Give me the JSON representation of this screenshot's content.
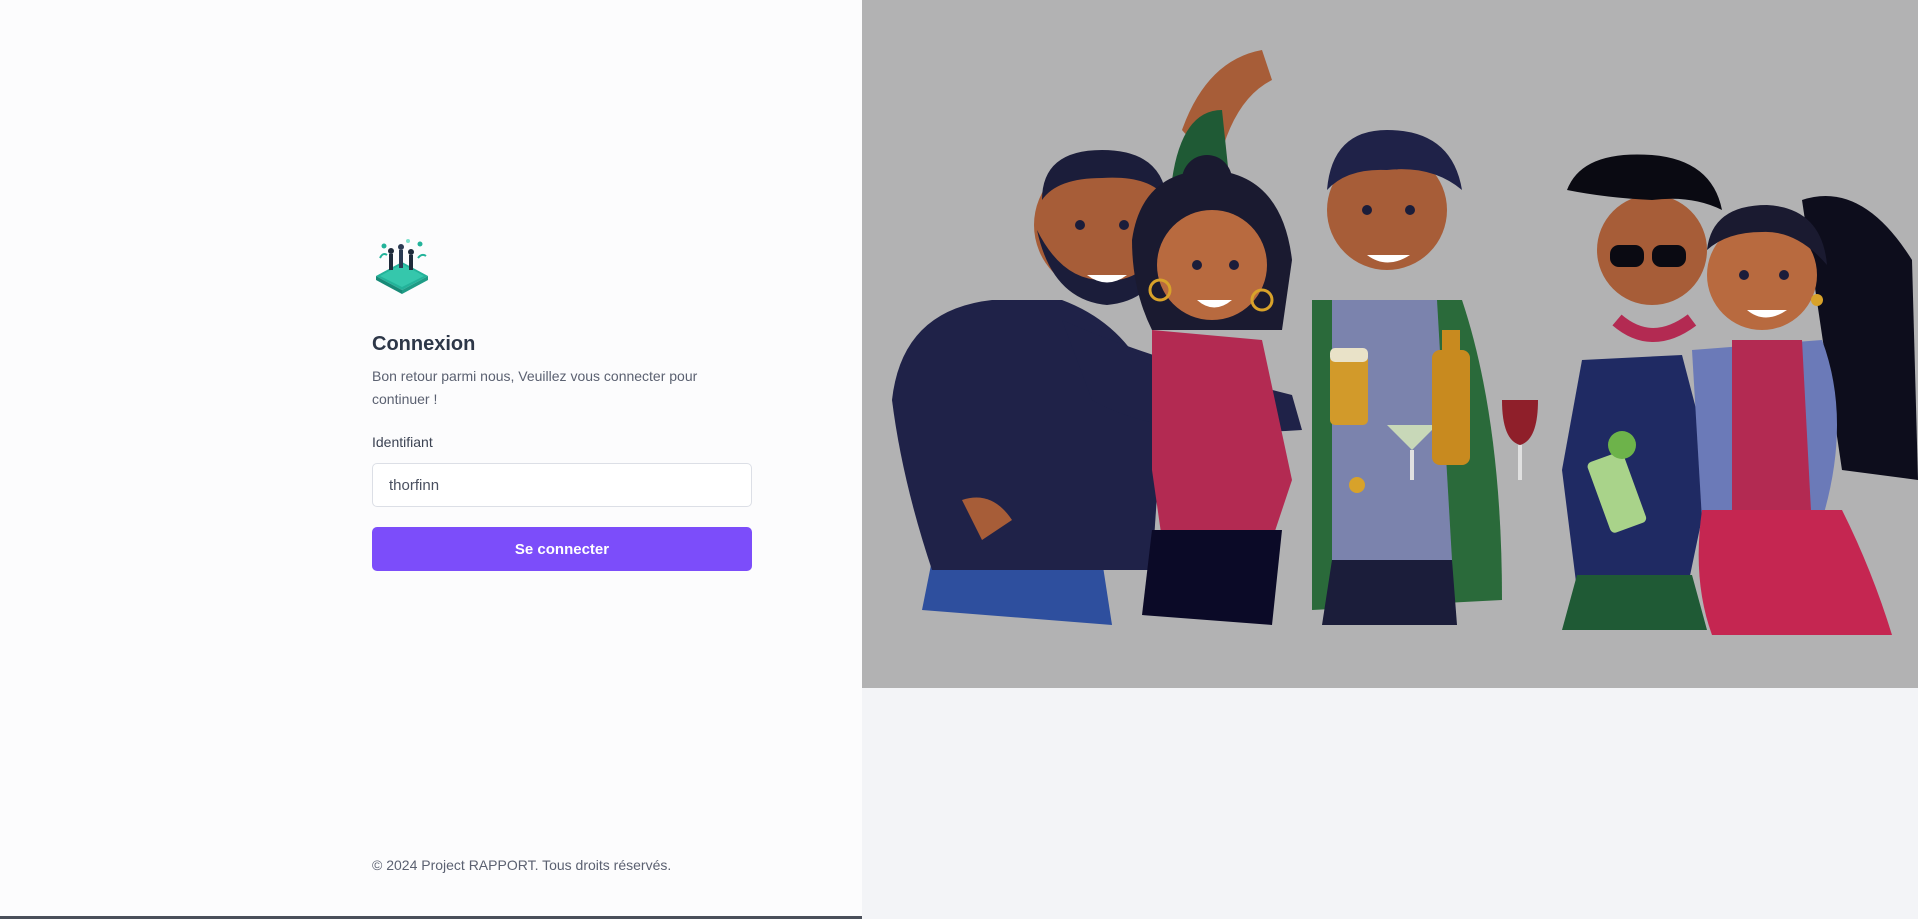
{
  "login": {
    "title": "Connexion",
    "subtitle": "Bon retour parmi nous, Veuillez vous connecter pour continuer !",
    "username_label": "Identifiant",
    "username_value": "thorfinn",
    "submit_label": "Se connecter",
    "logo_icon": "isometric-people-logo-icon"
  },
  "footer": {
    "copyright": "© 2024 Project RAPPORT. Tous droits réservés."
  },
  "hero": {
    "illustration": "group-of-friends-toasting-illustration"
  },
  "colors": {
    "accent": "#7c4dfa",
    "hero_background": "#b2b2b3",
    "right_background": "#f3f4f7",
    "title_text": "#2d3748"
  }
}
